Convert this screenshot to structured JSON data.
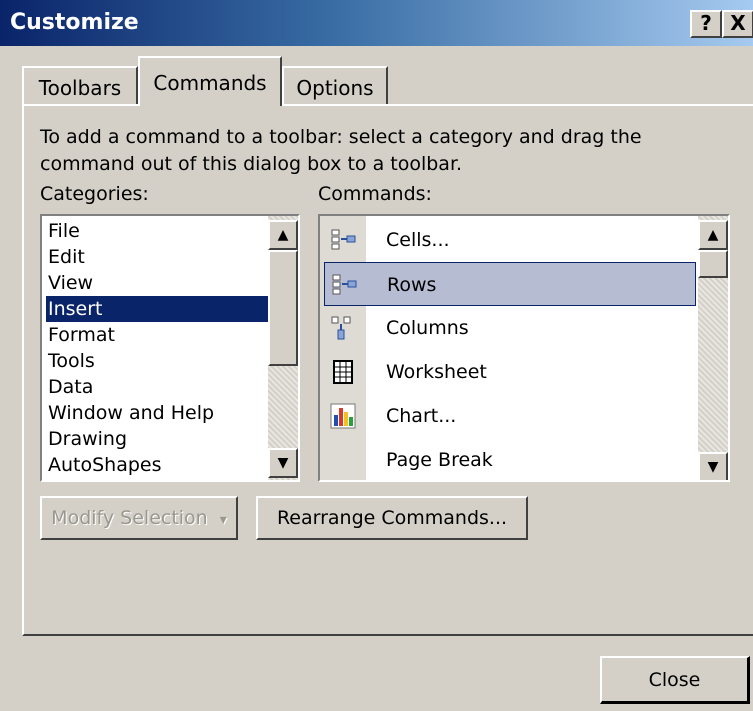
{
  "window": {
    "title": "Customize",
    "help_button": "?",
    "close_button": "X"
  },
  "tabs": [
    {
      "label": "Toolbars",
      "active": false
    },
    {
      "label": "Commands",
      "active": true
    },
    {
      "label": "Options",
      "active": false
    }
  ],
  "instructions": "To add a command to a toolbar: select a category and drag the command out of this dialog box to a toolbar.",
  "categories": {
    "label": "Categories:",
    "items": [
      "File",
      "Edit",
      "View",
      "Insert",
      "Format",
      "Tools",
      "Data",
      "Window and Help",
      "Drawing",
      "AutoShapes"
    ],
    "selected": "Insert"
  },
  "commands": {
    "label": "Commands:",
    "items": [
      {
        "label": "Cells...",
        "icon": "insert-cells-icon"
      },
      {
        "label": "Rows",
        "icon": "insert-rows-icon"
      },
      {
        "label": "Columns",
        "icon": "insert-columns-icon"
      },
      {
        "label": "Worksheet",
        "icon": "worksheet-icon"
      },
      {
        "label": "Chart...",
        "icon": "chart-icon"
      },
      {
        "label": "Page Break",
        "icon": ""
      }
    ],
    "selected": "Rows"
  },
  "buttons": {
    "modify_selection": "Modify Selection",
    "modify_selection_arrow": "▾",
    "rearrange_commands": "Rearrange Commands...",
    "close": "Close"
  },
  "scroll_arrows": {
    "up": "▲",
    "down": "▼"
  },
  "colors": {
    "title_start": "#0a246a",
    "title_end": "#a6caf0",
    "selection": "#0a246a",
    "command_highlight": "#b6bdd2",
    "face": "#d4d0c8"
  }
}
